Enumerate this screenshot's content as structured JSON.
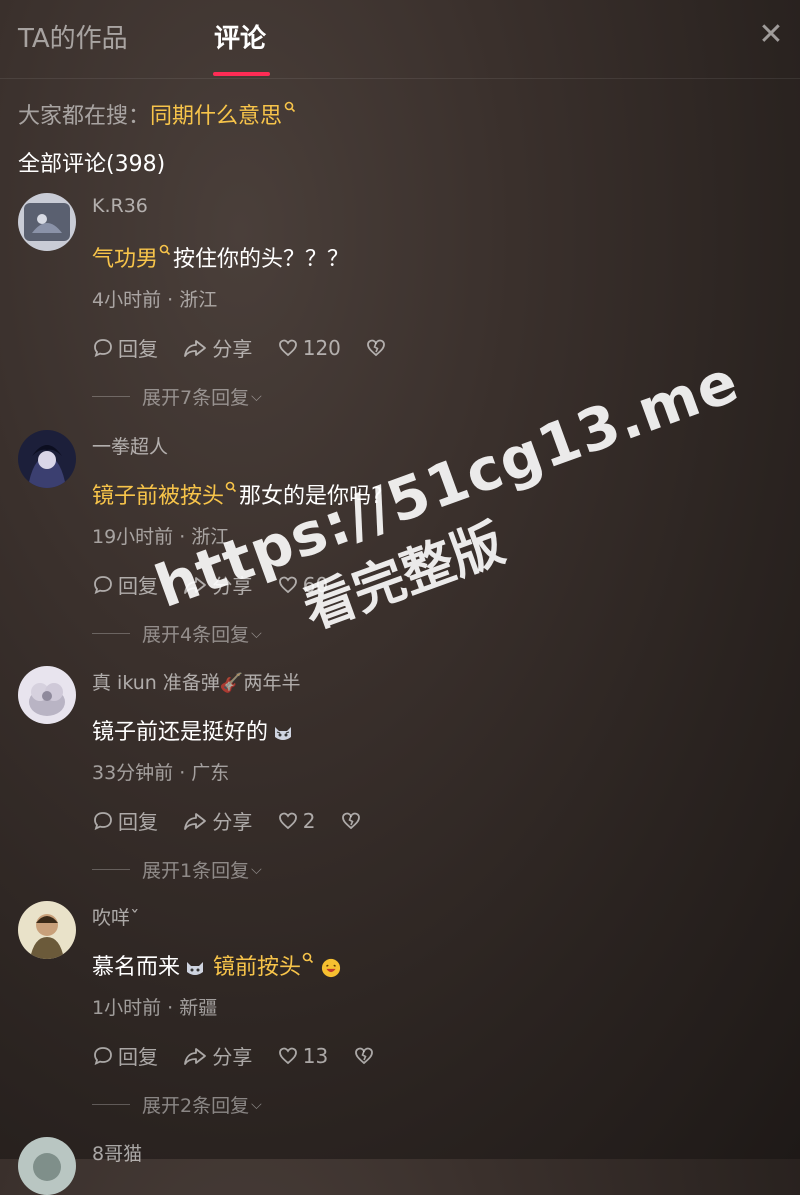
{
  "tabs": {
    "works": "TA的作品",
    "comments": "评论"
  },
  "search": {
    "prefix": "大家都在搜：",
    "term": "同期什么意思"
  },
  "comments_header": "全部评论(398)",
  "comments": [
    {
      "user": "K.R36",
      "highlight": "气功男",
      "text": "按住你的头？？？",
      "meta": "4小时前 · 浙江",
      "reply": "回复",
      "share": "分享",
      "likes": "120",
      "expand": "展开7条回复"
    },
    {
      "user": "一拳超人",
      "highlight": "镜子前被按头",
      "text": "那女的是你吗?",
      "meta": "19小时前 · 浙江",
      "reply": "回复",
      "share": "分享",
      "likes": "60",
      "expand": "展开4条回复"
    },
    {
      "user": "真 ikun 准备弹🎸两年半",
      "text": "镜子前还是挺好的",
      "meta": "33分钟前 · 广东",
      "reply": "回复",
      "share": "分享",
      "likes": "2",
      "expand": "展开1条回复"
    },
    {
      "user": "吹咩ˇ",
      "text_before": "慕名而来",
      "highlight": "镜前按头",
      "meta": "1小时前 · 新疆",
      "reply": "回复",
      "share": "分享",
      "likes": "13",
      "expand": "展开2条回复"
    },
    {
      "user": "8哥猫"
    }
  ],
  "watermark": {
    "line1": "https://51cg13.me",
    "line2": "看完整版"
  },
  "colors": {
    "accent": "#fe2c55",
    "highlight": "#f7c44a"
  }
}
